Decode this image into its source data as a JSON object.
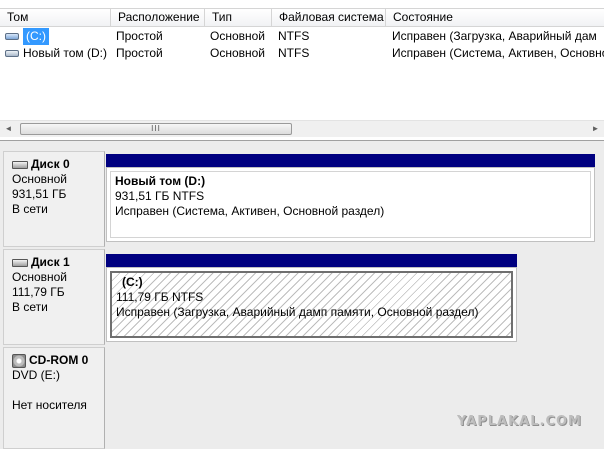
{
  "volume_list": {
    "columns": [
      {
        "label": "Том"
      },
      {
        "label": "Расположение"
      },
      {
        "label": "Тип"
      },
      {
        "label": "Файловая система"
      },
      {
        "label": "Состояние"
      }
    ],
    "rows": [
      {
        "name": "(C:)",
        "layout": "Простой",
        "type": "Основной",
        "fs": "NTFS",
        "status": "Исправен (Загрузка, Аварийный дам",
        "selected": true
      },
      {
        "name": "Новый том (D:)",
        "layout": "Простой",
        "type": "Основной",
        "fs": "NTFS",
        "status": "Исправен (Система, Активен, Основной р",
        "selected": false
      }
    ],
    "scrollbar": {
      "left_arrow": "◄",
      "right_arrow": "►",
      "thumb_grip": "III"
    }
  },
  "disks": [
    {
      "title": "Диск 0",
      "type": "Основной",
      "size": "931,51 ГБ",
      "state": "В сети",
      "partition": {
        "name": "Новый том  (D:)",
        "size_fs": "931,51 ГБ NTFS",
        "status": "Исправен (Система, Активен, Основной раздел)"
      }
    },
    {
      "title": "Диск 1",
      "type": "Основной",
      "size": "111,79 ГБ",
      "state": "В сети",
      "partition": {
        "name": "(C:)",
        "size_fs": "111,79 ГБ NTFS",
        "status": "Исправен (Загрузка, Аварийный дамп памяти, Основной раздел)"
      }
    }
  ],
  "cdrom": {
    "title": "CD-ROM 0",
    "drive": "DVD (E:)",
    "media": "Нет носителя"
  },
  "watermark": "YAPLAKAL.COM",
  "colors": {
    "partition_bar": "#000080",
    "selection": "#3399ff",
    "panel_bg": "#ececec"
  }
}
